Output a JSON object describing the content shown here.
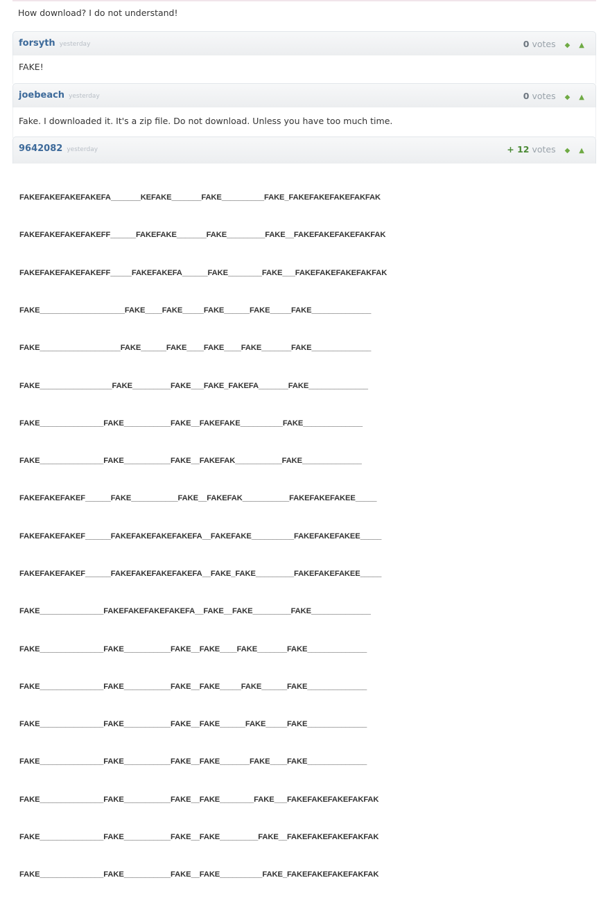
{
  "question": {
    "text": "How download? I do not understand!"
  },
  "comments": [
    {
      "author": "forsyth",
      "time": "yesterday",
      "votes_count": "0",
      "votes_label": "votes",
      "body": "FAKE!"
    },
    {
      "author": "joebeach",
      "time": "yesterday",
      "votes_count": "0",
      "votes_label": "votes",
      "body": "Fake. I downloaded it. It's a zip file. Do not download. Unless you have too much time."
    },
    {
      "author": "9642082",
      "time": "yesterday",
      "votes_count": "+ 12",
      "votes_label": "votes",
      "ascii_lines": [
        "FAKEFAKEFAKEFAKEFA_______KEFAKE_______FAKE__________FAKE_FAKEFAKEFAKEFAKFAK",
        "FAKEFAKEFAKEFAKEFF______FAKEFAKE_______FAKE_________FAKE__FAKEFAKEFAKEFAKFAK",
        "FAKEFAKEFAKEFAKEFF_____FAKEFAKEFA______FAKE________FAKE___FAKEFAKEFAKEFAKFAK",
        "FAKE____________________FAKE____FAKE_____FAKE______FAKE_____FAKE______________",
        "FAKE___________________FAKE______FAKE____FAKE____FAKE_______FAKE______________",
        "FAKE_________________FAKE_________FAKE___FAKE_FAKEFA_______FAKE______________",
        "FAKE_______________FAKE___________FAKE__FAKEFAKE__________FAKE______________",
        "FAKE_______________FAKE___________FAKE__FAKEFAK___________FAKE______________",
        "FAKEFAKEFAKEF______FAKE___________FAKE__FAKEFAK___________FAKEFAKEFAKEE_____",
        "FAKEFAKEFAKEF______FAKEFAKEFAKEFAKEFA__FAKEFAKE__________FAKEFAKEFAKEE_____",
        "FAKEFAKEFAKEF______FAKEFAKEFAKEFAKEFA__FAKE_FAKE_________FAKEFAKEFAKEE_____",
        "FAKE_______________FAKEFAKEFAKEFAKEFA__FAKE__FAKE_________FAKE______________",
        "FAKE_______________FAKE___________FAKE__FAKE____FAKE_______FAKE______________",
        "FAKE_______________FAKE___________FAKE__FAKE_____FAKE______FAKE______________",
        "FAKE_______________FAKE___________FAKE__FAKE______FAKE_____FAKE______________",
        "FAKE_______________FAKE___________FAKE__FAKE_______FAKE____FAKE______________",
        "FAKE_______________FAKE___________FAKE__FAKE________FAKE___FAKEFAKEFAKEFAKFAK",
        "FAKE_______________FAKE___________FAKE__FAKE_________FAKE__FAKEFAKEFAKEFAKFAK",
        "FAKE_______________FAKE___________FAKE__FAKE__________FAKE_FAKEFAKEFAKEFAKFAK"
      ]
    }
  ],
  "colors": {
    "author": "#3d6a9a",
    "vote_arrow": "#6faa44",
    "positive_count": "#4b8a35",
    "header_bg": "#eceef0"
  },
  "icons": {
    "upvote": "up-arrow-icon",
    "downvote": "down-arrow-icon"
  }
}
